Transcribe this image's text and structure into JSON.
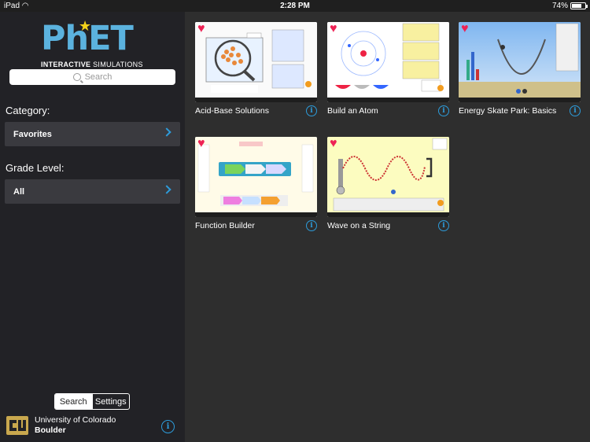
{
  "status": {
    "carrier": "iPad",
    "time": "2:28 PM",
    "battery": "74%",
    "battery_level": 0.74
  },
  "logo": {
    "wordmark": "PhET",
    "tagline_bold": "INTERACTIVE",
    "tagline_rest": " SIMULATIONS"
  },
  "search": {
    "placeholder": "Search"
  },
  "category": {
    "label": "Category:",
    "value": "Favorites"
  },
  "grade": {
    "label": "Grade Level:",
    "value": "All"
  },
  "segment": {
    "search": "Search",
    "settings": "Settings"
  },
  "university": {
    "line1": "University of Colorado",
    "line2": "Boulder"
  },
  "simulations": [
    {
      "title": "Acid-Base Solutions"
    },
    {
      "title": "Build an Atom"
    },
    {
      "title": "Energy Skate Park: Basics"
    },
    {
      "title": "Function Builder"
    },
    {
      "title": "Wave on a String"
    }
  ],
  "colors": {
    "accent": "#2d9cdb",
    "heart": "#ee2255",
    "phet_blue": "#5bb2de",
    "phet_star": "#f4d21a"
  }
}
